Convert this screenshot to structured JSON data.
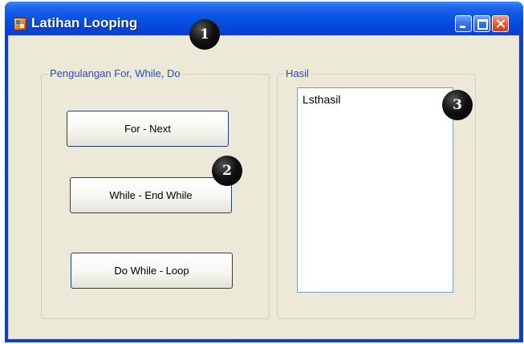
{
  "window": {
    "title": "Latihan Looping",
    "icon": "app-form-icon",
    "caption_buttons": [
      "minimize-icon",
      "maximize-icon",
      "close-icon"
    ]
  },
  "group_loop": {
    "legend": "Pengulangan For, While, Do",
    "buttons": {
      "for_next": "For - Next",
      "while_end": "While - End While",
      "do_while": "Do While - Loop"
    }
  },
  "group_hasil": {
    "legend": "Hasil",
    "listbox_text": "Lsthasil"
  },
  "markers": [
    "1",
    "2",
    "3"
  ],
  "colors": {
    "titlebar": "#0a55e6",
    "client_bg": "#ece9d8",
    "legend_text": "#1f4fcf",
    "close_button": "#e05a33"
  }
}
